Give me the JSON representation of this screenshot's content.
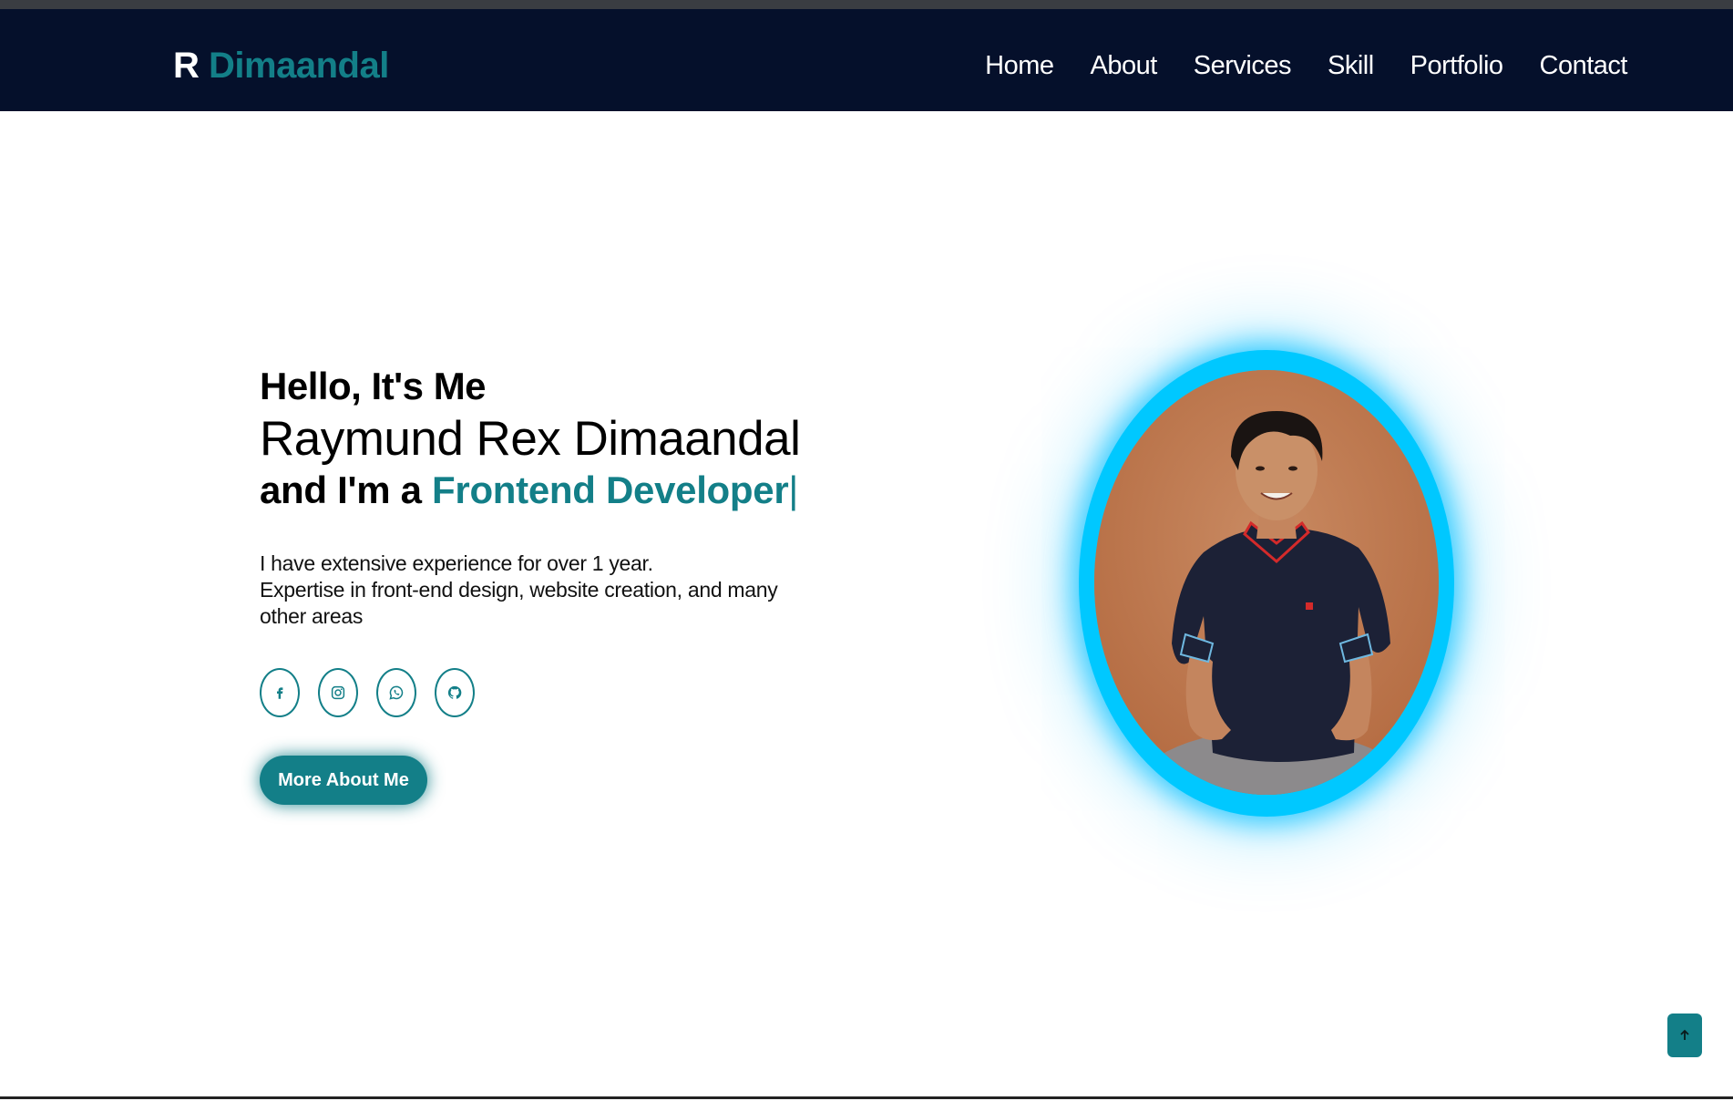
{
  "header": {
    "logo_initial": "R",
    "logo_name": "Dimaandal",
    "nav": [
      "Home",
      "About",
      "Services",
      "Skill",
      "Portfolio",
      "Contact"
    ]
  },
  "hero": {
    "greeting": "Hello, It's Me",
    "name": "Raymund Rex Dimaandal",
    "role_prefix": "and I'm a ",
    "role": "Frontend Developer",
    "cursor": "|",
    "description_line1": "I have extensive experience for over 1 year.",
    "description_line2": "Expertise in front-end design, website creation, and many other areas",
    "socials": [
      "facebook-icon",
      "instagram-icon",
      "whatsapp-icon",
      "github-icon"
    ],
    "cta_label": "More About Me"
  },
  "scroll_top": {
    "icon": "arrow-up-icon"
  },
  "colors": {
    "nav_bg": "#05102b",
    "accent": "#137f88",
    "portrait_ring": "#00c8ff"
  }
}
